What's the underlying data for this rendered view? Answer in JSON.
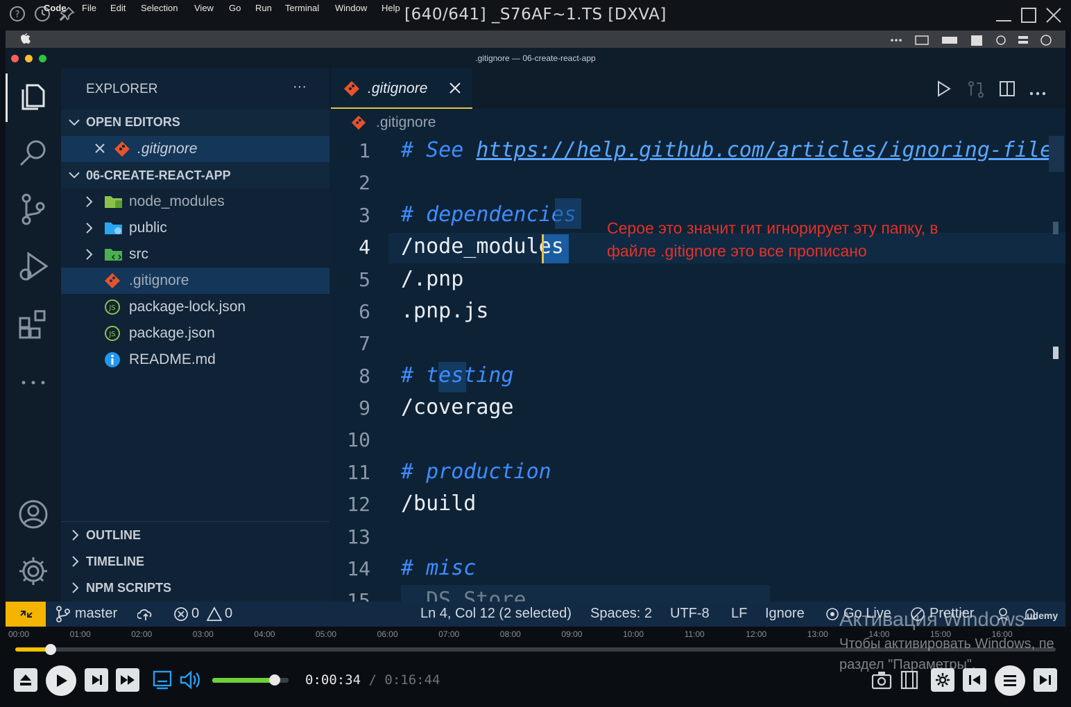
{
  "player": {
    "title": "[640/641] _S76AF~1.TS [DXVA]",
    "time_current": "0:00:34",
    "time_sep": " / ",
    "time_total": "0:16:44",
    "timeline_ticks": [
      "00:00",
      "01:00",
      "02:00",
      "03:00",
      "04:00",
      "05:00",
      "06:00",
      "07:00",
      "08:00",
      "09:00",
      "10:00",
      "11:00",
      "12:00",
      "13:00",
      "14:00",
      "15:00",
      "16:00"
    ],
    "progress": 0.034,
    "volume": 0.82
  },
  "menubar": {
    "items": [
      "Code",
      "File",
      "Edit",
      "Selection",
      "View",
      "Go",
      "Run",
      "Terminal",
      "Window",
      "Help"
    ]
  },
  "window": {
    "title": ".gitignore — 06-create-react-app"
  },
  "sidebar": {
    "title": "EXPLORER",
    "more": "···",
    "open_editors_label": "OPEN EDITORS",
    "open_editor_file": ".gitignore",
    "project_label": "06-CREATE-REACT-APP",
    "files": [
      {
        "name": "node_modules",
        "type": "folder"
      },
      {
        "name": "public",
        "type": "folder"
      },
      {
        "name": "src",
        "type": "folder"
      },
      {
        "name": ".gitignore",
        "type": "git"
      },
      {
        "name": "package-lock.json",
        "type": "json"
      },
      {
        "name": "package.json",
        "type": "json"
      },
      {
        "name": "README.md",
        "type": "info"
      }
    ],
    "outline_label": "OUTLINE",
    "timeline_label": "TIMELINE",
    "npm_label": "NPM SCRIPTS"
  },
  "editor": {
    "tab_label": ".gitignore",
    "breadcrumb": ".gitignore",
    "line_numbers": [
      "1",
      "2",
      "3",
      "4",
      "5",
      "6",
      "7",
      "8",
      "9",
      "10",
      "11",
      "12",
      "13",
      "14",
      "15"
    ],
    "lines": {
      "l1_hash": "# See ",
      "l1_url": "https://help.github.com/articles/ignoring-files",
      "l3": "# dependencies",
      "l4": "/node_modules",
      "l5": "/.pnp",
      "l6": ".pnp.js",
      "l8": "# testing",
      "l9": "/coverage",
      "l11": "# production",
      "l12": "/build",
      "l14": "# misc",
      "l15": ".DS_Store"
    },
    "annotation_line1": "Серое это значит гит игнорирует эту папку, в",
    "annotation_line2": "файле .gitignore это все прописано"
  },
  "status": {
    "branch": "master",
    "errors": "0",
    "warnings": "0",
    "position": "Ln 4, Col 12 (2 selected)",
    "spaces": "Spaces: 2",
    "encoding": "UTF-8",
    "eol": "LF",
    "language": "Ignore",
    "golive": "Go Live",
    "prettier": "Prettier",
    "udemy": "udemy"
  },
  "watermark": {
    "line1": "Активация Windows",
    "line2": "Чтобы активировать Windows, пе",
    "line3": "раздел \"Параметры\"."
  }
}
